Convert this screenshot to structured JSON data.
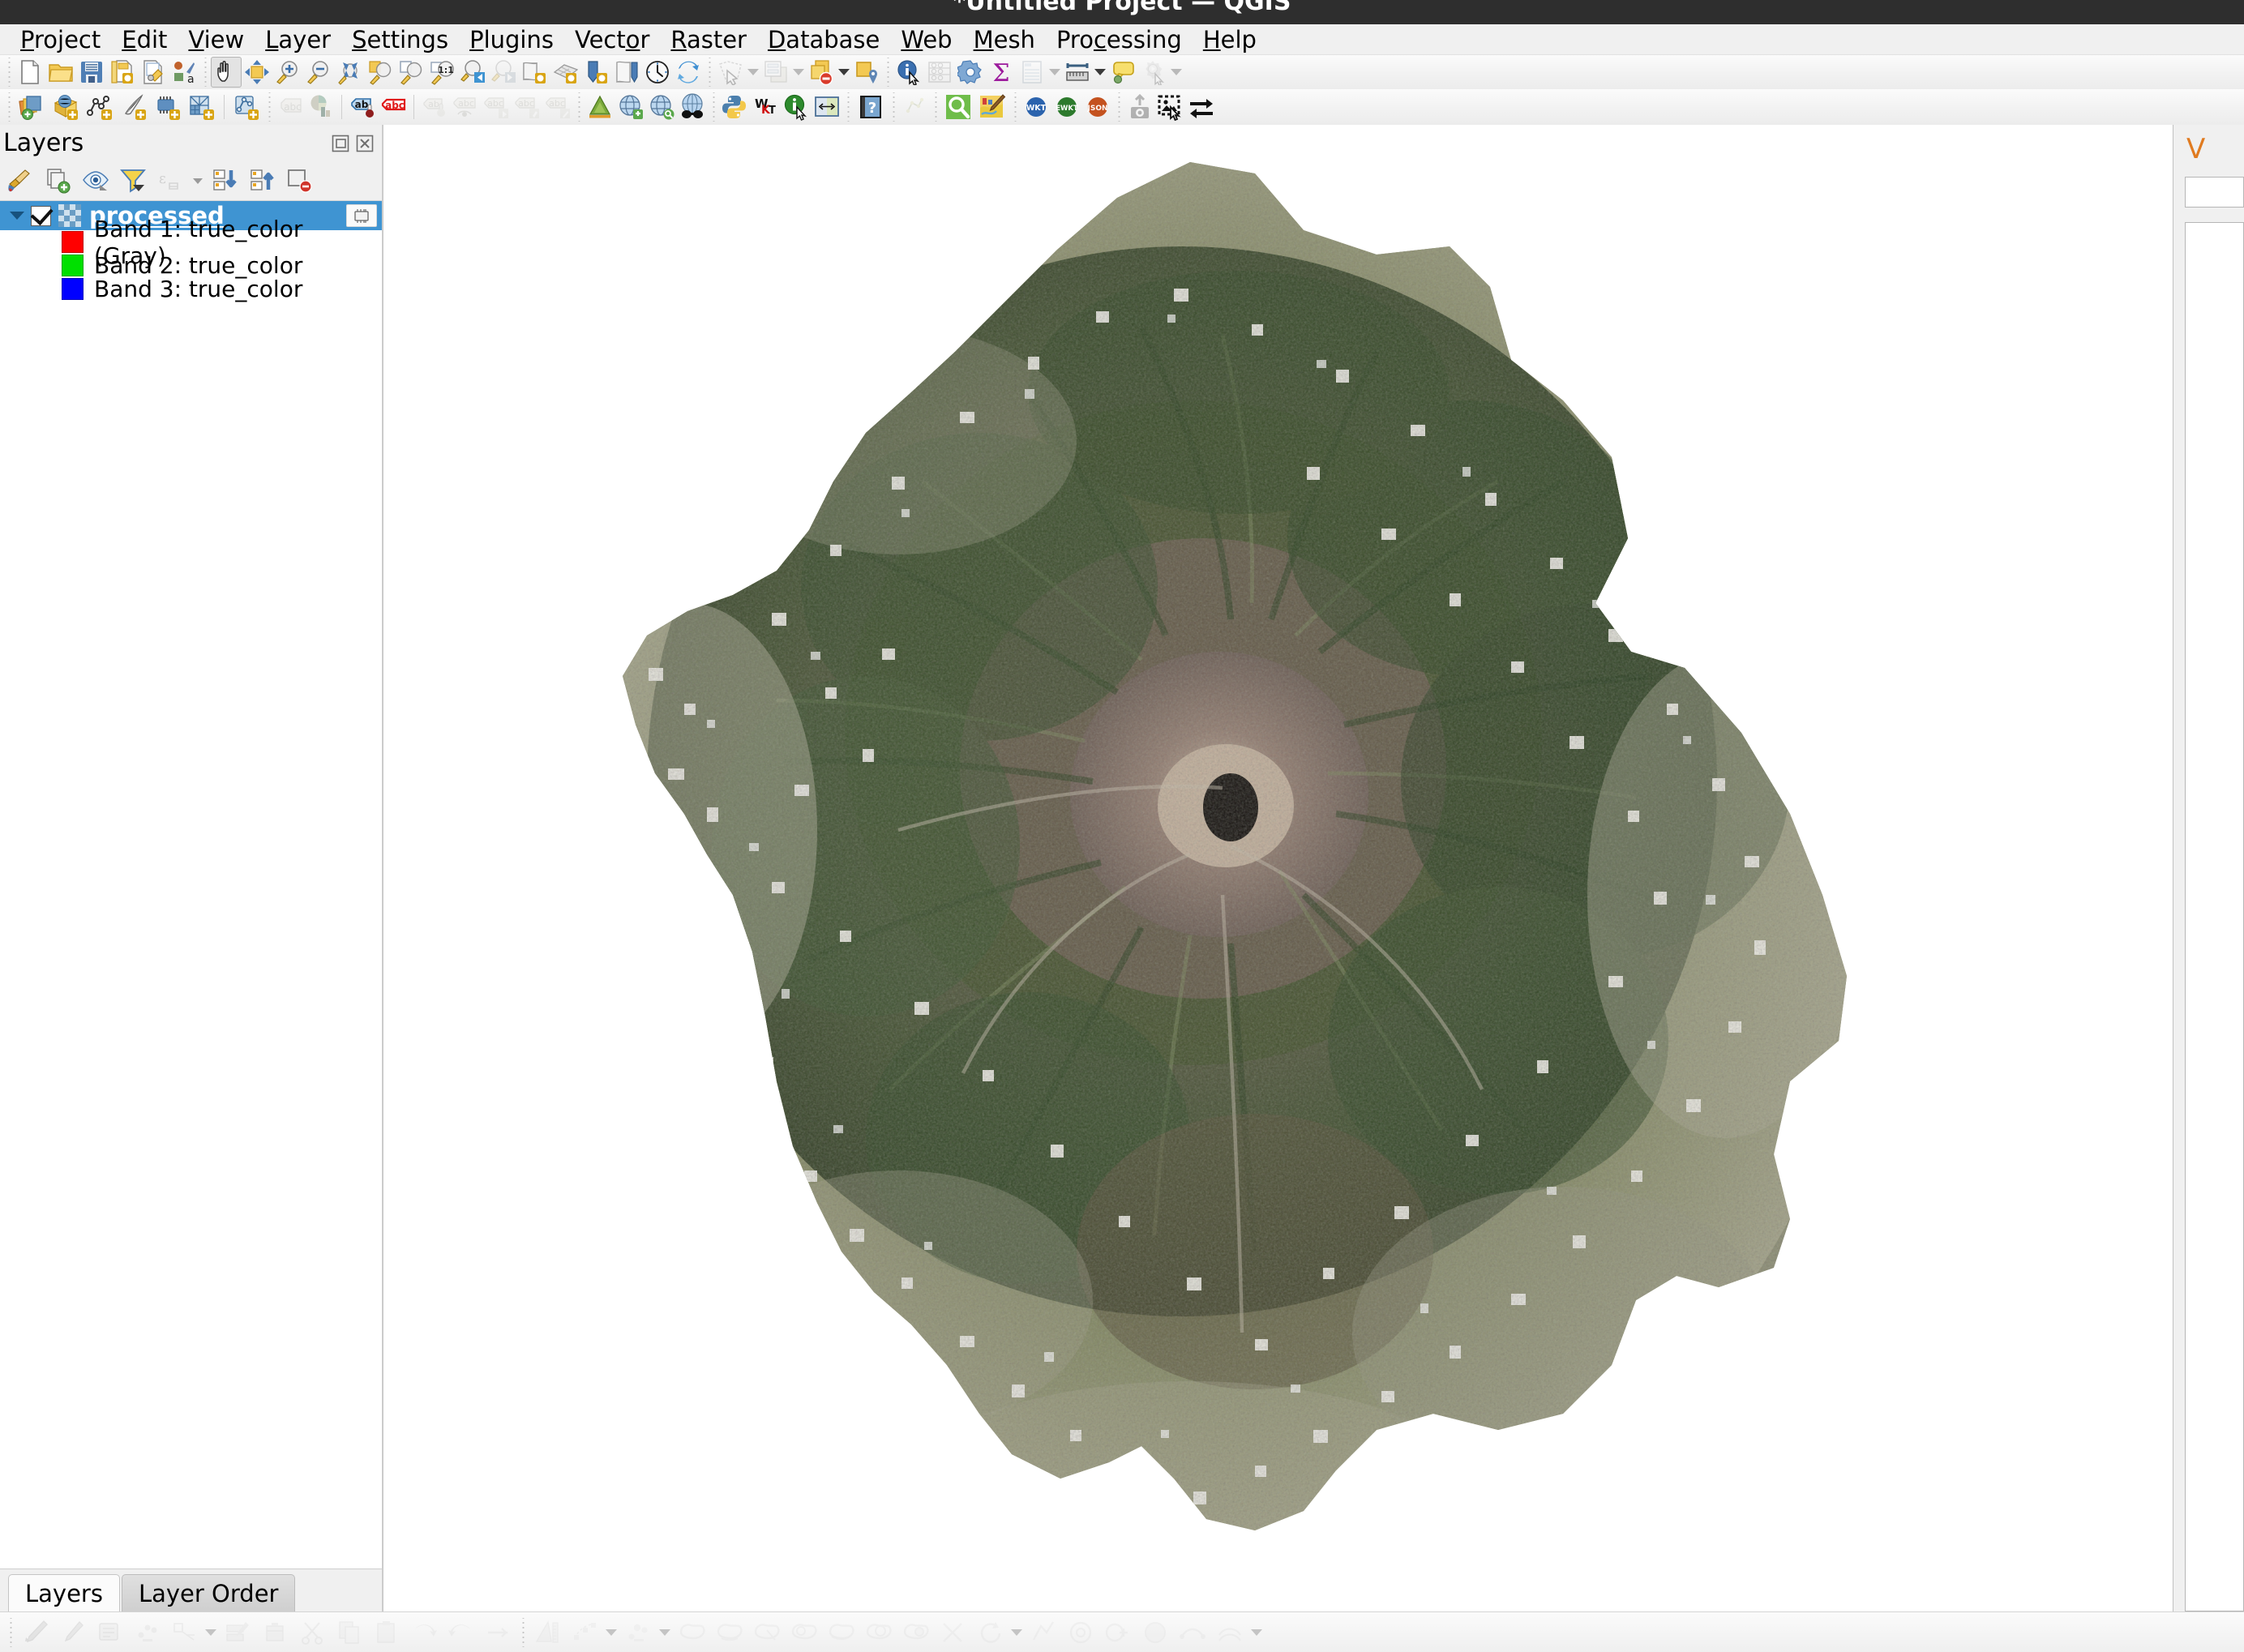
{
  "window": {
    "title": "*Untitled Project — QGIS"
  },
  "menubar": {
    "items": [
      {
        "label": "Project",
        "mnemonic": "P"
      },
      {
        "label": "Edit",
        "mnemonic": "E"
      },
      {
        "label": "View",
        "mnemonic": "V"
      },
      {
        "label": "Layer",
        "mnemonic": "L"
      },
      {
        "label": "Settings",
        "mnemonic": "S"
      },
      {
        "label": "Plugins",
        "mnemonic": "P"
      },
      {
        "label": "Vector",
        "mnemonic": "o"
      },
      {
        "label": "Raster",
        "mnemonic": "R"
      },
      {
        "label": "Database",
        "mnemonic": "D"
      },
      {
        "label": "Web",
        "mnemonic": "W"
      },
      {
        "label": "Mesh",
        "mnemonic": "M"
      },
      {
        "label": "Processing",
        "mnemonic": "c"
      },
      {
        "label": "Help",
        "mnemonic": "H"
      }
    ]
  },
  "toolbar_row1": {
    "icons": [
      "new-project-icon",
      "open-project-icon",
      "save-project-icon",
      "new-print-layout-icon",
      "style-manager-icon",
      "style-dock-icon",
      "pan-map-icon",
      "pan-to-selection-icon",
      "zoom-in-icon",
      "zoom-out-icon",
      "zoom-full-icon",
      "zoom-to-selection-icon",
      "zoom-to-layer-icon",
      "zoom-native-resolution-icon",
      "zoom-last-icon",
      "zoom-next-icon",
      "new-map-view-icon",
      "new-3d-map-view-icon",
      "new-print-layout2-icon",
      "layout-manager-icon",
      "temporal-controller-icon",
      "refresh-icon",
      "select-features-icon",
      "select-value-icon",
      "deselect-icon",
      "select-by-location-icon",
      "identify-features-icon",
      "field-calculator-icon",
      "options-icon",
      "statistical-summary-icon",
      "attribute-table-icon",
      "measure-line-icon",
      "map-tips-icon",
      "run-feature-action-icon"
    ]
  },
  "toolbar_row2": {
    "icons": [
      "data-source-manager-icon",
      "add-vector-layer-icon",
      "add-raster-layer-icon",
      "add-delimited-text-icon",
      "add-mesh-layer-icon",
      "add-wms-layer-icon",
      "add-vector-tile-icon",
      "label-abc-icon",
      "diagram-icon",
      "highlight-pinned-labels-icon",
      "pin-labels-icon",
      "show-hide-labels-icon",
      "move-label-icon",
      "rotate-label-icon",
      "change-label-icon",
      "georeferencer-icon",
      "metasearch-icon",
      "gps-tools-icon",
      "coordinate-capture-icon",
      "python-console-icon",
      "wkt-tool-icon",
      "info-identify-icon",
      "swipe-tool-icon",
      "help-icon",
      "topology-checker-icon",
      "search-layers-icon",
      "map-styling-icon",
      "wkt-badge-icon",
      "ewkt-badge-icon",
      "json-badge-icon",
      "upload-snapshot-icon",
      "image-select-icon",
      "swap-arrows-icon"
    ]
  },
  "layers_panel": {
    "title": "Layers",
    "header_buttons": [
      "float-panel-icon",
      "close-panel-icon"
    ],
    "toolbar_icons": [
      "open-layer-styling-icon",
      "add-group-icon",
      "manage-map-themes-icon",
      "filter-legend-icon",
      "filter-legend-expression-icon",
      "expand-all-icon",
      "collapse-all-icon",
      "remove-layer-icon"
    ],
    "tree": {
      "layer": {
        "name": "processed",
        "checked": true,
        "expanded": true,
        "selected": true,
        "type_icon": "raster-layer-icon",
        "bands": [
          {
            "label": "Band 1: true_color (Gray)",
            "color": "#ff0000"
          },
          {
            "label": "Band 2: true_color",
            "color": "#00e000"
          },
          {
            "label": "Band 3: true_color",
            "color": "#0000ff"
          }
        ]
      }
    },
    "tabs": [
      {
        "label": "Layers",
        "active": true
      },
      {
        "label": "Layer Order",
        "active": false
      }
    ]
  },
  "right_dock": {
    "title_fragment": "V"
  },
  "map_canvas": {
    "background": "#ffffff",
    "raster_layer_name": "processed",
    "description": "True-color satellite raster of a stratovolcano with summit crater, irregular clipped footprint on white background"
  }
}
